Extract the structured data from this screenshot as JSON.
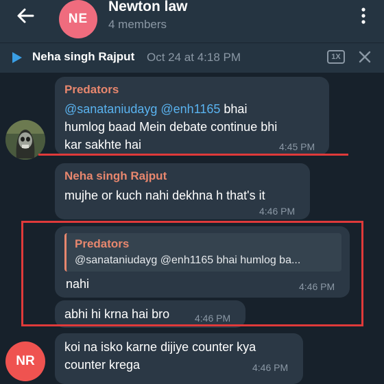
{
  "header": {
    "avatar_initials": "NE",
    "title": "Newton law",
    "subtitle": "4 members"
  },
  "pinned": {
    "name": "Neha singh Rajput",
    "time": "Oct 24 at 4:18 PM",
    "speed": "1X"
  },
  "messages": [
    {
      "sender": "Predators",
      "mention1": "@sanataniudayg",
      "mention2": "@enh1165",
      "text_after_mentions": " bhai",
      "line2": "humlog baad Mein debate continue bhi",
      "line3": "kar sakhte hai",
      "time": "4:45 PM"
    },
    {
      "sender": "Neha singh Rajput",
      "text": "mujhe or kuch nahi dekhna h that's it",
      "time": "4:46 PM"
    },
    {
      "quote_name": "Predators",
      "quote_text": "@sanataniudayg @enh1165 bhai humlog ba...",
      "text": "nahi",
      "time": "4:46 PM"
    },
    {
      "text": "abhi hi krna hai bro",
      "time": "4:46 PM"
    },
    {
      "avatar_initials": "NR",
      "line1": "koi na isko karne dijiye counter kya",
      "line2": "counter krega",
      "time": "4:46 PM"
    }
  ],
  "colors": {
    "accent_link": "#5ab3f0",
    "sender_name": "#e8876e",
    "highlight": "#e03a3a",
    "avatar_ne": "#ef6c7e",
    "avatar_nr": "#ef5350"
  }
}
